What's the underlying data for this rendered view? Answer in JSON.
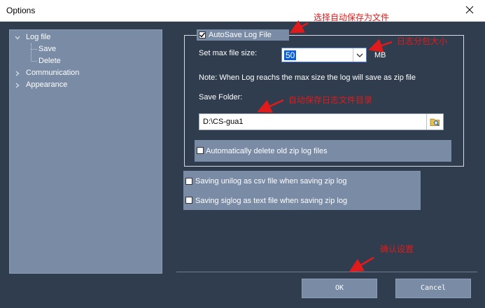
{
  "window": {
    "title": "Options"
  },
  "tree": {
    "items": [
      {
        "label": "Log file",
        "expanded": true
      },
      {
        "label": "Save"
      },
      {
        "label": "Delete"
      },
      {
        "label": "Communication",
        "expanded": false
      },
      {
        "label": "Appearance",
        "expanded": false
      }
    ]
  },
  "logfile": {
    "autosave_label": "AutoSave Log File",
    "autosave_checked": true,
    "max_size_label": "Set max file size:",
    "max_size_value": "50",
    "max_size_unit": "MB",
    "note": "Note: When Log reachs the max size the log will save as zip file",
    "save_folder_label": "Save Folder:",
    "save_folder_value": "D:\\CS-gua1",
    "auto_delete_label": "Automatically delete old zip log files",
    "auto_delete_checked": false
  },
  "extra": {
    "csv_label": "Saving unilog as csv file when saving zip log",
    "text_label": "Saving siglog as text file when saving zip log"
  },
  "buttons": {
    "ok": "OK",
    "cancel": "Cancel"
  },
  "annotations": {
    "autosave": "选择自动保存为文件",
    "size": "日志分包大小",
    "folder": "自动保存日志文件目录",
    "confirm": "确认设置",
    "color": "#e01b1b"
  },
  "colors": {
    "background": "#2f3d4e",
    "panel": "#7a8ba6",
    "accent": "#0a5fd6"
  }
}
